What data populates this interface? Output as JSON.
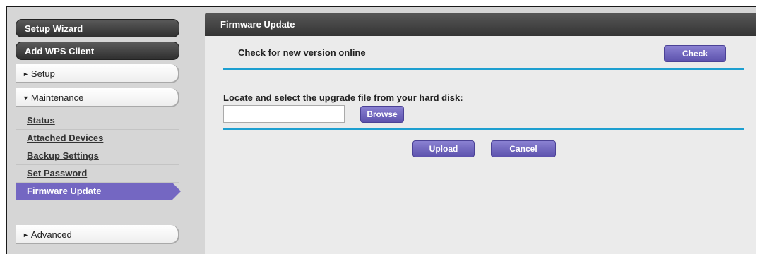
{
  "sidebar": {
    "setup_wizard": "Setup Wizard",
    "add_wps_client": "Add WPS Client",
    "setup": "Setup",
    "maintenance": "Maintenance",
    "maintenance_items": [
      "Status",
      "Attached Devices",
      "Backup Settings",
      "Set Password",
      "Firmware Update"
    ],
    "advanced": "Advanced",
    "collapsed_arrow": "►",
    "expanded_arrow": "▼"
  },
  "main": {
    "title": "Firmware Update",
    "check_online_label": "Check for new version online",
    "check_button": "Check",
    "locate_label": "Locate and select the upgrade file from your hard disk:",
    "file_value": "",
    "browse_button": "Browse",
    "upload_button": "Upload",
    "cancel_button": "Cancel"
  },
  "colors": {
    "accent_purple": "#7467c2",
    "rule_blue": "#1d9fd0",
    "header_dark": "#3a3a3a"
  }
}
